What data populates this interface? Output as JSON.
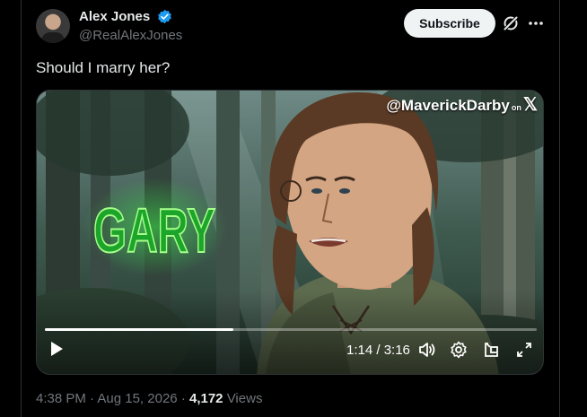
{
  "author": {
    "display_name": "Alex Jones",
    "handle": "@RealAlexJones",
    "verified_color": "#1d9bf0"
  },
  "actions": {
    "subscribe_label": "Subscribe",
    "grok_icon": "grok-icon",
    "more_icon": "more-icon"
  },
  "tweet": {
    "text": "Should I marry her?"
  },
  "media": {
    "watermark_handle": "@MaverickDarby",
    "watermark_on": "on",
    "watermark_logo": "𝕏",
    "overlay_text": "GARY",
    "overlay_color": "#3bff4a",
    "progress": 0.3833,
    "time_display": "1:14 / 3:16",
    "icons": [
      "play-icon",
      "volume-icon",
      "settings-gear-icon",
      "picture-in-picture-icon",
      "fullscreen-icon"
    ]
  },
  "meta": {
    "time": "4:38 PM",
    "separator": "·",
    "date": "Aug 15, 2026",
    "views_count": "4,172",
    "views_label": "Views"
  }
}
